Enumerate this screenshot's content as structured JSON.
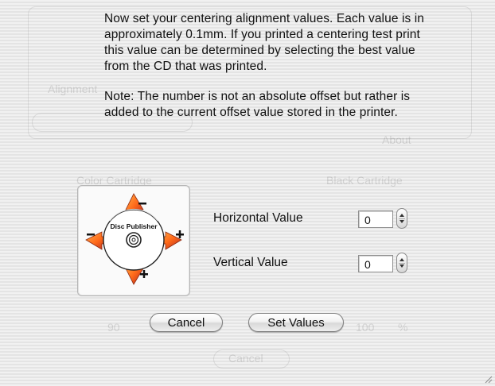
{
  "dialog": {
    "message": "Now set your centering alignment values.  Each value is in approximately 0.1mm.  If you printed a centering test print this value can be determined by selecting the best value from the CD that was printed.",
    "note": "Note:  The number is not an absolute offset but rather is added to the current offset value stored in the printer."
  },
  "figure": {
    "icon": "disc-alignment-icon",
    "disc_label": "Disc Publisher"
  },
  "horizontal": {
    "label": "Horizontal Value",
    "value": "0"
  },
  "vertical": {
    "label": "Vertical Value",
    "value": "0"
  },
  "buttons": {
    "cancel": "Cancel",
    "set_values": "Set Values"
  },
  "background": {
    "alignment": "Alignment",
    "color_cartridge": "Color Cartridge",
    "black_cartridge": "Black Cartridge",
    "about": "About",
    "cancel": "Cancel",
    "left_value": "90",
    "right_value": "100",
    "unit": "%"
  },
  "colors": {
    "arrow": "#ff7a1a",
    "arrow_dark": "#a0201a",
    "accent": "#000000"
  }
}
